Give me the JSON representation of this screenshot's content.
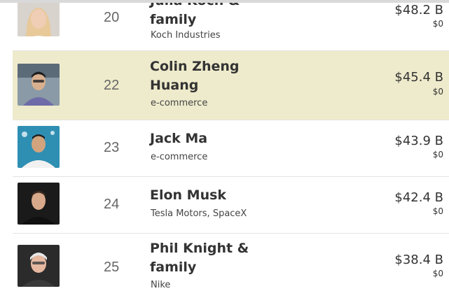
{
  "rows": [
    {
      "rank": "20",
      "name_line1": "Julia Koch &",
      "name_line2": "family",
      "source": "Koch Industries",
      "net_worth": "$48.2 B",
      "change": "$0",
      "highlighted": false
    },
    {
      "rank": "22",
      "name_line1": "Colin Zheng",
      "name_line2": "Huang",
      "source": "e-commerce",
      "net_worth": "$45.4 B",
      "change": "$0",
      "highlighted": true
    },
    {
      "rank": "23",
      "name_line1": "Jack Ma",
      "name_line2": "",
      "source": "e-commerce",
      "net_worth": "$43.9 B",
      "change": "$0",
      "highlighted": false
    },
    {
      "rank": "24",
      "name_line1": "Elon Musk",
      "name_line2": "",
      "source": "Tesla Motors, SpaceX",
      "net_worth": "$42.4 B",
      "change": "$0",
      "highlighted": false
    },
    {
      "rank": "25",
      "name_line1": "Phil Knight &",
      "name_line2": "family",
      "source": "Nike",
      "net_worth": "$38.4 B",
      "change": "$0",
      "highlighted": false
    }
  ],
  "colors": {
    "highlight": "#eeebcc",
    "divider": "#e3e3e3",
    "text": "#333333"
  }
}
